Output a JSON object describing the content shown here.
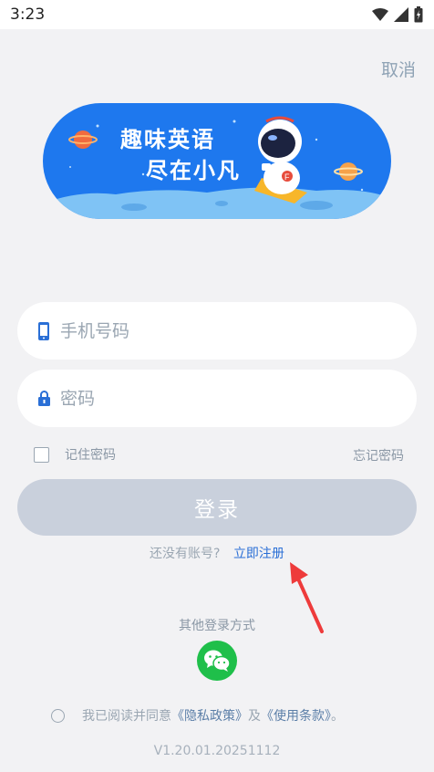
{
  "status_bar": {
    "time": "3:23"
  },
  "header": {
    "cancel_label": "取消"
  },
  "banner": {
    "line1": "趣味英语",
    "line2": "尽在小凡"
  },
  "form": {
    "phone_placeholder": "手机号码",
    "password_placeholder": "密码",
    "remember_label": "记住密码",
    "forgot_label": "忘记密码",
    "login_label": "登录"
  },
  "register": {
    "prompt": "还没有账号?",
    "link": "立即注册"
  },
  "other_login": {
    "label": "其他登录方式",
    "icon": "wechat-icon"
  },
  "agreement": {
    "prefix": "我已阅读并同意",
    "privacy": "《隐私政策》",
    "conj": "及",
    "terms": "《使用条款》",
    "suffix": "。"
  },
  "version": "V1.20.01.20251112",
  "colors": {
    "accent": "#2a6fd6",
    "login_disabled": "#c9d0dc",
    "wechat": "#1fbf4a",
    "arrow": "#ee3b3b",
    "banner": "#1e78ee"
  }
}
